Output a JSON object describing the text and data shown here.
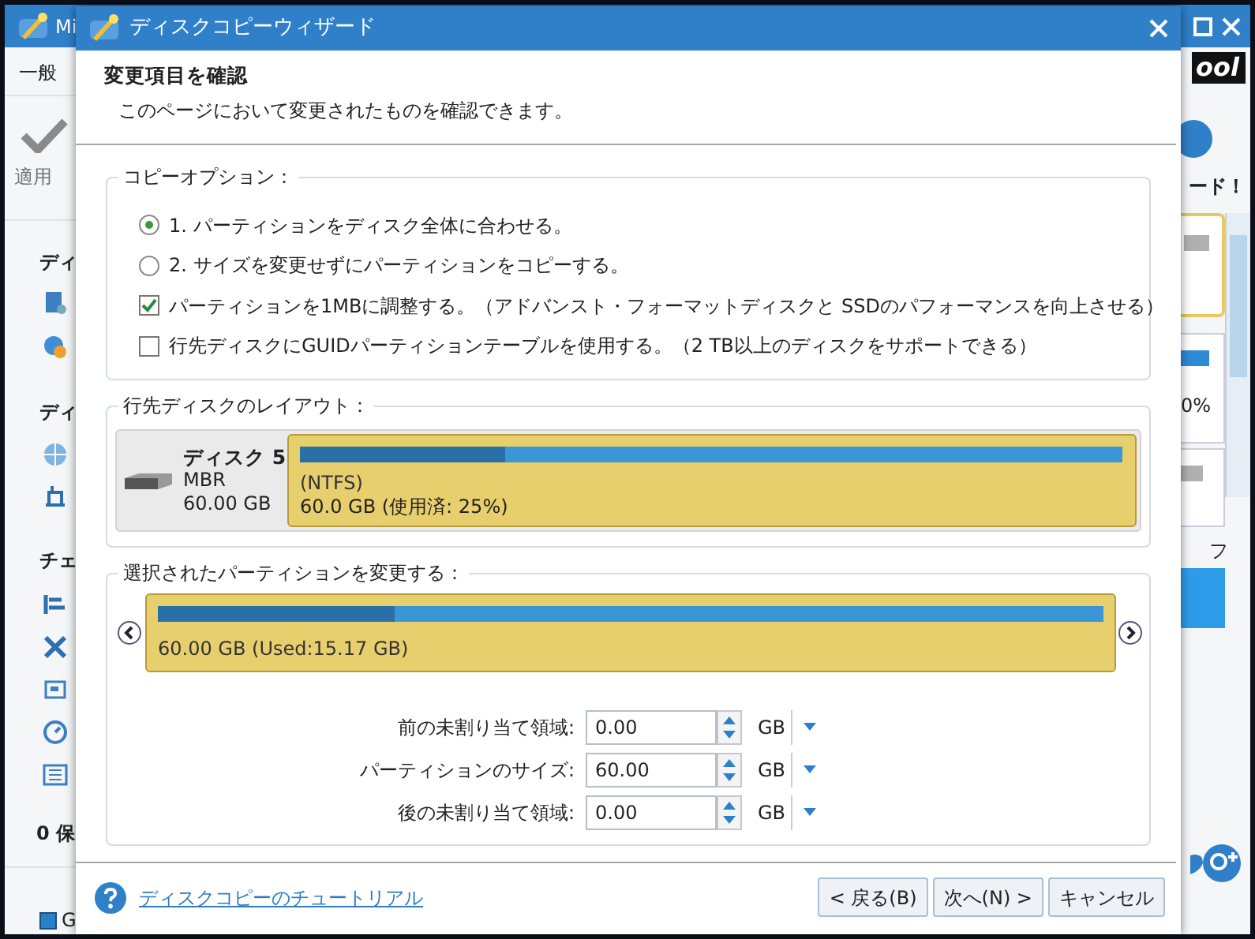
{
  "background_window": {
    "title": "Mi",
    "menu": [
      "一般"
    ],
    "toolbar_label": "適用",
    "sidebar_headings": [
      "ディ",
      "ディ",
      "チェ"
    ],
    "footer_heading": "0 保",
    "legend_label": "G",
    "logo": "ool",
    "banner": "ード！",
    "percent": "0%",
    "column_label": "フ"
  },
  "dialog": {
    "title": "ディスクコピーウィザード",
    "heading": "変更項目を確認",
    "subheading": "このページにおいて変更されたものを確認できます。",
    "copy_options": {
      "title": "コピーオプション：",
      "options": [
        {
          "kind": "radio",
          "label": "1. パーティションをディスク全体に合わせる。",
          "selected": true
        },
        {
          "kind": "radio",
          "label": "2. サイズを変更せずにパーティションをコピーする。",
          "selected": false
        },
        {
          "kind": "checkbox",
          "label": "パーティションを1MBに調整する。（アドバンスト・フォーマットディスクと SSDのパフォーマンスを向上させる）",
          "checked": true
        },
        {
          "kind": "checkbox",
          "label": "行先ディスクにGUIDパーティションテーブルを使用する。（2 TB以上のディスクをサポートできる）",
          "checked": false
        }
      ]
    },
    "layout": {
      "title": "行先ディスクのレイアウト：",
      "disk": {
        "name": "ディスク 5",
        "scheme": "MBR",
        "size": "60.00 GB"
      },
      "partition": {
        "filesystem": "(NTFS)",
        "info": "60.0 GB (使用済: 25%)",
        "level": 0.25
      }
    },
    "edit": {
      "title": "選択されたパーティションを変更する：",
      "partition": {
        "info": "60.00 GB (Used:15.17 GB)",
        "level": 0.25
      },
      "fields": [
        {
          "label": "前の未割り当て領域:",
          "value": "0.00",
          "unit": "GB"
        },
        {
          "label": "パーティションのサイズ:",
          "value": "60.00",
          "unit": "GB"
        },
        {
          "label": "後の未割り当て領域:",
          "value": "0.00",
          "unit": "GB"
        }
      ]
    },
    "help_link": "ディスクコピーのチュートリアル",
    "buttons": [
      "< 戻る(B)",
      "次へ(N) >",
      "キャンセル"
    ]
  }
}
